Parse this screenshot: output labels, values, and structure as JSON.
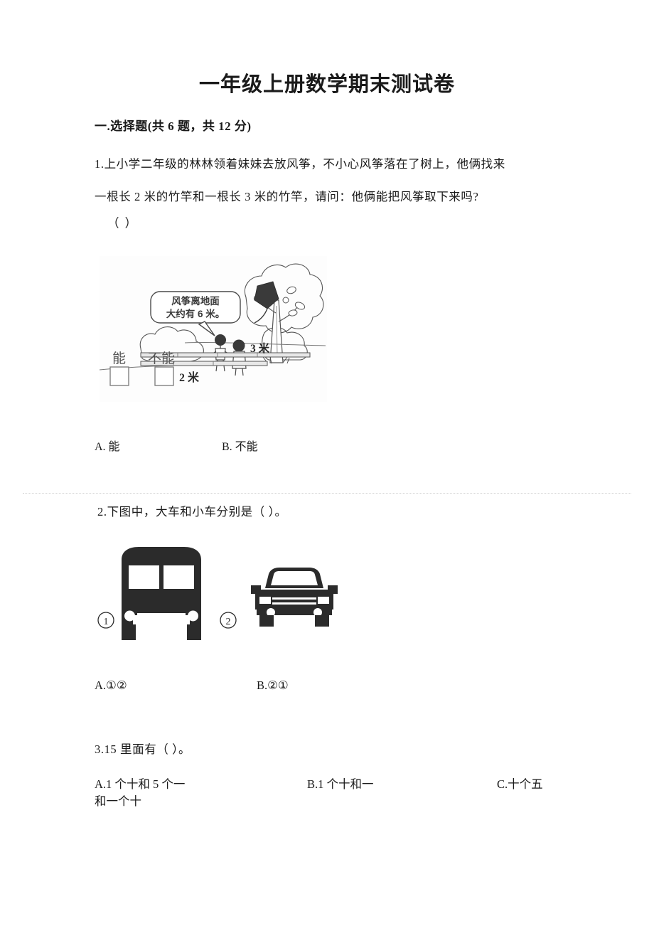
{
  "document": {
    "title": "一年级上册数学期末测试卷",
    "section_header": "一.选择题(共 6 题，共 12 分)"
  },
  "questions": [
    {
      "number": "1",
      "line1": "1.上小学二年级的林林领着妹妹去放风筝，不小心风筝落在了树上，他俩找来",
      "line2": "一根长 2 米的竹竿和一根长 3 米的竹竿，请问：他俩能把风筝取下来吗?",
      "answer_blank": "（          ）",
      "figure": {
        "name": "kite-in-tree-illustration",
        "speech_bubble_line1": "风筝离地面",
        "speech_bubble_line2": "大约有 6 米。",
        "checkbox_label_1": "能",
        "checkbox_label_2": "不能",
        "pole_label_top": "3 米",
        "pole_label_bottom": "2 米"
      },
      "options": [
        {
          "key": "A",
          "text": "A. 能"
        },
        {
          "key": "B",
          "text": "B. 不能"
        }
      ]
    },
    {
      "number": "2",
      "line1": "2.下图中，大车和小车分别是（          ）。",
      "figure": {
        "name": "bus-and-car-illustration",
        "item1_label": "①",
        "item2_label": "②"
      },
      "options": [
        {
          "key": "A",
          "text": "A.①②"
        },
        {
          "key": "B",
          "text": "B.②①"
        }
      ]
    },
    {
      "number": "3",
      "line1": "3.15 里面有（          ）。",
      "options": [
        {
          "key": "A",
          "text": "A.1 个十和 5 个一"
        },
        {
          "key": "A2",
          "text": "和一个十"
        },
        {
          "key": "B",
          "text": "B.1 个十和一"
        },
        {
          "key": "C",
          "text": "C.十个五"
        }
      ]
    }
  ],
  "colors": {
    "text": "#1a1a1a",
    "divider": "#cfcfcf",
    "ink": "#3a3a3a"
  }
}
